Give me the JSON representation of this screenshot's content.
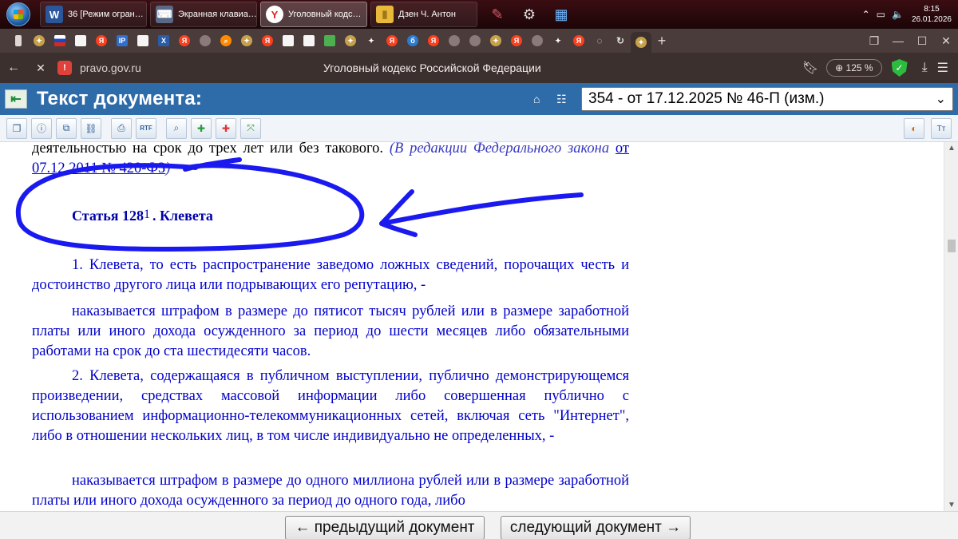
{
  "taskbar": {
    "tasks": [
      {
        "label": "36 [Режим огран…",
        "icon": "word-icon",
        "icon_text": "W",
        "color": "#2b579a"
      },
      {
        "label": "Экранная клавиа…",
        "icon": "keyboard-icon",
        "icon_text": "⌨",
        "color": "#5a6a86"
      },
      {
        "label": "Уголовный кодс…",
        "icon": "yandex-browser-icon",
        "icon_text": "Y",
        "color": "#ffffff"
      },
      {
        "label": "Дзен Ч. Антон",
        "icon": "folder-icon",
        "icon_text": "▮",
        "color": "#e8b93a"
      }
    ],
    "tray_lang": "",
    "clock_time": "8:15",
    "clock_date": "26.01.2026"
  },
  "browser": {
    "url": "pravo.gov.ru",
    "title": "Уголовный кодекс Российской Федерации",
    "zoom": "125 %"
  },
  "doc_header": {
    "title": "Текст документа:",
    "edition": "354 - от 17.12.2025 № 46-П (изм.)"
  },
  "document": {
    "top_text": "деятельностью на срок до трех лет или без такового.",
    "top_edit_note": "(В редакции Федерального закона",
    "top_edit_link": "от 07.12.2011 № 420-ФЗ",
    "top_edit_close": ")",
    "article_prefix": "Статья 128",
    "article_sup": "1",
    "article_title": ". Клевета",
    "p1": "1. Клевета, то есть распространение заведомо ложных сведений, порочащих честь и достоинство другого лица или подрывающих его репутацию, -",
    "p2": "наказывается штрафом в размере до пятисот тысяч рублей или в размере заработной платы или иного дохода осужденного за период до шести месяцев либо обязательными работами на срок до ста шестидесяти часов.",
    "p3": "2. Клевета, содержащаяся в публичном выступлении, публично демонстрирующемся произведении, средствах массовой информации либо совершенная публично с использованием информационно-телекоммуникационных сетей, включая сеть \"Интернет\", либо в отношении нескольких лиц, в том числе индивидуально не определенных, -",
    "p4": "наказывается штрафом в размере до одного миллиона рублей или в размере заработной платы или иного дохода осужденного за период до одного года, либо"
  },
  "footer": {
    "prev": "← предыдущий документ",
    "next": "следующий документ →"
  },
  "colors": {
    "header_blue": "#2e6ba9",
    "doc_text_blue": "#0000cc",
    "ink": "#1a1af0"
  }
}
